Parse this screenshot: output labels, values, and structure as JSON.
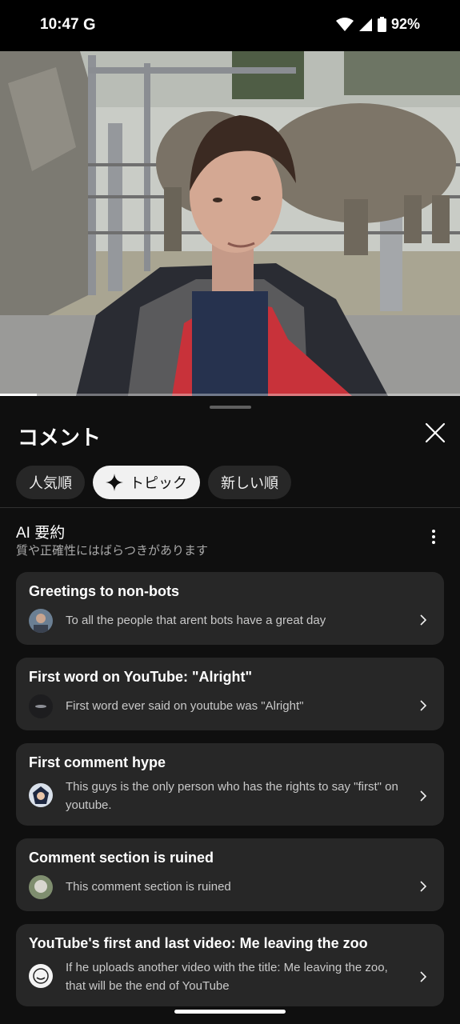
{
  "status_bar": {
    "time": "10:47",
    "g_label": "G",
    "battery": "92%"
  },
  "video": {
    "progress_fraction": 0.08
  },
  "comments": {
    "title": "コメント",
    "chips": [
      {
        "label": "人気順",
        "active": false
      },
      {
        "label": "トピック",
        "active": true
      },
      {
        "label": "新しい順",
        "active": false
      }
    ],
    "ai_summary": {
      "title": "AI 要約",
      "subtitle": "質や正確性にはばらつきがあります"
    },
    "topics": [
      {
        "title": "Greetings to non-bots",
        "text": "To all the people that arent bots have a great day"
      },
      {
        "title": "First word on YouTube: \"Alright\"",
        "text": "First word ever said on youtube was \"Alright\""
      },
      {
        "title": "First comment hype",
        "text": "This guys is the only person who has the rights to say \"first\" on youtube."
      },
      {
        "title": "Comment section is ruined",
        "text": "This comment section is ruined"
      },
      {
        "title": "YouTube's first and last video: Me leaving the zoo",
        "text": "If he uploads another video with the title: Me leaving the zoo, that will be the end of YouTube"
      }
    ]
  },
  "colors": {
    "background": "#0f0f0f",
    "card": "#272727",
    "chip": "#272727",
    "chip_active": "#f1f1f1",
    "text_secondary": "#aaaaaa"
  }
}
